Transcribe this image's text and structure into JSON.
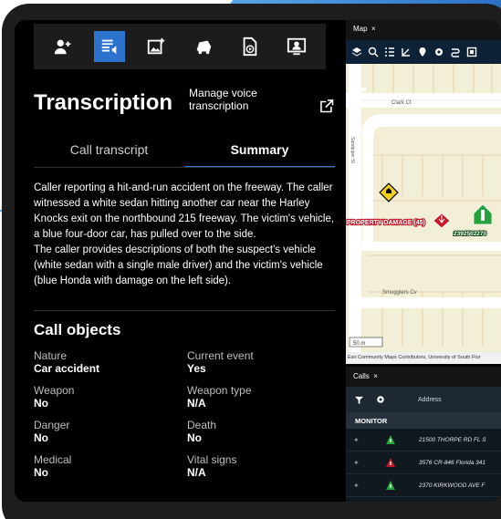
{
  "toolbar": {
    "items": [
      {
        "icon": "add-person-icon",
        "active": false
      },
      {
        "icon": "transcription-icon",
        "active": true
      },
      {
        "icon": "add-image-icon",
        "active": false
      },
      {
        "icon": "vehicle-icon",
        "active": false
      },
      {
        "icon": "video-file-icon",
        "active": false
      },
      {
        "icon": "person-screen-icon",
        "active": false
      }
    ],
    "accent": "#2b73cc"
  },
  "transcription": {
    "title": "Transcription",
    "manage_label": "Manage voice transcription"
  },
  "tabs": [
    {
      "label": "Call transcript",
      "active": false
    },
    {
      "label": "Summary",
      "active": true
    }
  ],
  "summary": {
    "p1": "Caller reporting a hit-and-run accident on the freeway. The caller witnessed a white sedan hitting another car near the Harley Knocks exit on the northbound 215 freeway. The victim's vehicle, a blue four-door car, has pulled over to the side.",
    "p2": "The caller provides descriptions of both the suspect's vehicle (white sedan with a single male driver) and the victim's vehicle (blue Honda with damage on the left side)."
  },
  "call_objects": {
    "title": "Call objects",
    "items": [
      {
        "label": "Nature",
        "value": "Car accident"
      },
      {
        "label": "Current event",
        "value": "Yes"
      },
      {
        "label": "Weapon",
        "value": "No"
      },
      {
        "label": "Weapon type",
        "value": "N/A"
      },
      {
        "label": "Danger",
        "value": "No"
      },
      {
        "label": "Death",
        "value": "No"
      },
      {
        "label": "Medical",
        "value": "No"
      },
      {
        "label": "Vital signs",
        "value": "N/A"
      }
    ]
  },
  "map": {
    "tab_label": "Map",
    "close": "×",
    "streets": [
      "Clark Ct",
      "Sandpiper St",
      "Smugglers Cv"
    ],
    "incident_label": "PROPERTY DAMAGE (45)",
    "unit_label": "2392502270",
    "scale": "50 m",
    "attribution": "Esri Community Maps Contributors, University of South Flor"
  },
  "calls": {
    "tab_label": "Calls",
    "close": "×",
    "address_header": "Address",
    "monitor": "MONITOR",
    "rows": [
      {
        "address": "21500 THORPE RD FL S",
        "status": "green"
      },
      {
        "address": "3576 CR-846 Florida 341",
        "status": "red"
      },
      {
        "address": "2370 KIRKWOOD AVE F",
        "status": "green"
      }
    ]
  }
}
